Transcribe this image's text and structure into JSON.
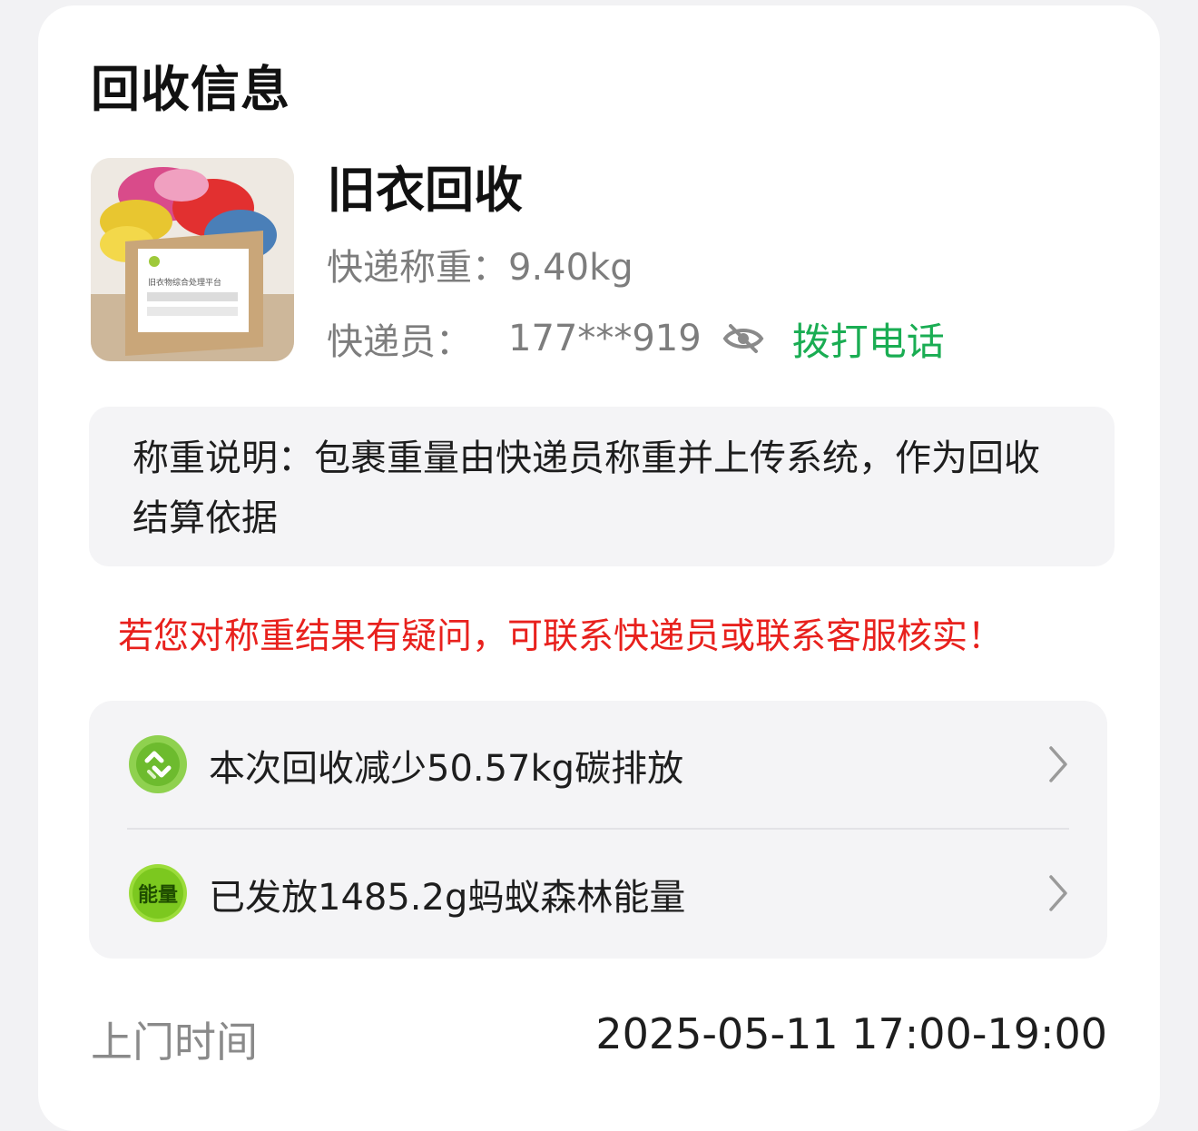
{
  "section": {
    "title": "回收信息"
  },
  "item": {
    "title": "旧衣回收",
    "image_icon": "clothes-box-photo",
    "box_print": "旧衣物综合处理平台"
  },
  "weight": {
    "label": "快递称重：",
    "value": "9.40kg"
  },
  "courier": {
    "label": "快递员：",
    "phone": "177***919",
    "eye_icon": "eye-hidden-icon",
    "call_label": "拨打电话",
    "call_color": "#1aad53"
  },
  "note": {
    "text": "称重说明：包裹重量由快递员称重并上传系统，作为回收结算依据"
  },
  "warning": {
    "text": "若您对称重结果有疑问，可联系快递员或联系客服核实！",
    "color": "#e8211d"
  },
  "eco": {
    "rows": [
      {
        "icon": "recycle-icon",
        "text": "本次回收减少50.57kg碳排放"
      },
      {
        "icon": "energy-badge-icon",
        "icon_text": "能量",
        "text": "已发放1485.2g蚂蚁森林能量"
      }
    ]
  },
  "visit": {
    "label": "上门时间",
    "value": "2025-05-11 17:00-19:00"
  }
}
